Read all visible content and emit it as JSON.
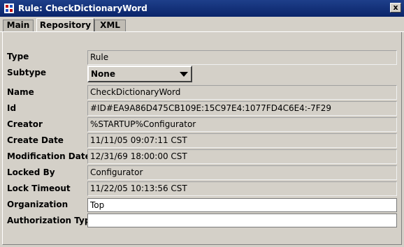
{
  "window": {
    "title": "Rule: CheckDictionaryWord",
    "close_label": "x"
  },
  "tabs": [
    {
      "label": "Main"
    },
    {
      "label": "Repository",
      "active": true
    },
    {
      "label": "XML"
    }
  ],
  "fields": {
    "type": {
      "label": "Type",
      "value": "Rule"
    },
    "subtype": {
      "label": "Subtype",
      "value": "None"
    },
    "name": {
      "label": "Name",
      "value": "CheckDictionaryWord"
    },
    "id": {
      "label": "Id",
      "value": "#ID#EA9A86D475CB109E:15C97E4:1077FD4C6E4:-7F29"
    },
    "creator": {
      "label": "Creator",
      "value": "%STARTUP%Configurator"
    },
    "create_date": {
      "label": "Create Date",
      "value": "11/11/05 09:07:11 CST"
    },
    "modification_date": {
      "label": "Modification Date",
      "value": "12/31/69 18:00:00 CST"
    },
    "locked_by": {
      "label": "Locked By",
      "value": "Configurator"
    },
    "lock_timeout": {
      "label": "Lock Timeout",
      "value": "11/22/05 10:13:56 CST"
    },
    "organization": {
      "label": "Organization",
      "value": "Top"
    },
    "authorization_type": {
      "label": "Authorization Type",
      "value": ""
    }
  },
  "colors": {
    "titlebar": "#0a246a",
    "panel": "#d4d0c8"
  }
}
